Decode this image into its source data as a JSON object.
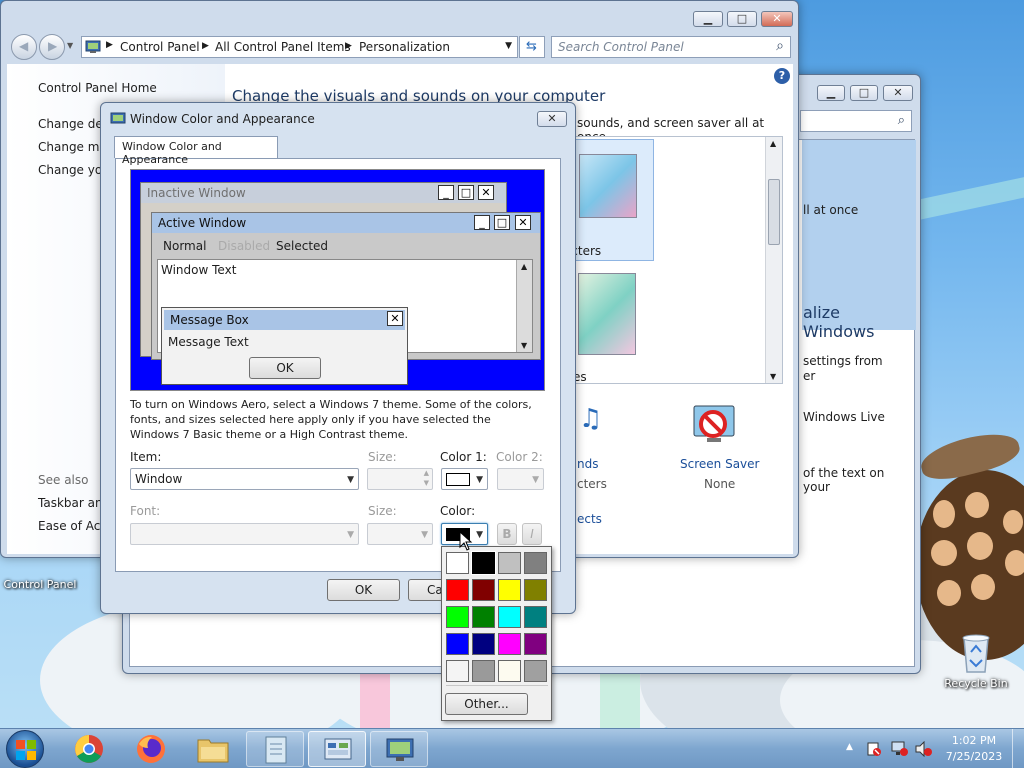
{
  "colors": {
    "selection_blue": "#0000ff",
    "link": "#1a4e99",
    "title_inactive": "#cfdcec"
  },
  "cp": {
    "breadcrumb": [
      "Control Panel",
      "All Control Panel Items",
      "Personalization"
    ],
    "search_placeholder": "Search Control Panel",
    "sidebar": {
      "home": "Control Panel Home",
      "links": [
        "Change des",
        "Change mo",
        "Change you"
      ],
      "see_also": "See also",
      "see_links": [
        "Taskbar and",
        "Ease of Acce"
      ]
    },
    "heading": "Change the visuals and sounds on your computer",
    "subtext": "sounds, and screen saver all at once.",
    "theme_captions": [
      "racters",
      "enes"
    ],
    "screen_saver": "Screen Saver",
    "screen_saver_value": "None",
    "side_items": [
      "nds",
      "cters",
      "ects"
    ]
  },
  "back": {
    "partial_texts": [
      "ll at once",
      "alize Windows",
      "settings from",
      "er",
      "Windows Live",
      "of the text on your"
    ]
  },
  "dialog": {
    "title": "Window Color and Appearance",
    "tab": "Window Color and Appearance",
    "preview": {
      "inactive_title": "Inactive Window",
      "active_title": "Active Window",
      "menu": [
        "Normal",
        "Disabled",
        "Selected"
      ],
      "window_text": "Window Text",
      "msgbox_title": "Message Box",
      "msgbox_text": "Message Text",
      "msgbox_ok": "OK"
    },
    "info": "To turn on Windows Aero, select a Windows 7 theme.  Some of the colors, fonts, and sizes selected here apply only if you have selected the Windows 7 Basic theme or a High Contrast theme.",
    "item_label": "Item:",
    "item_value": "Window",
    "size_label": "Size:",
    "color1_label": "Color 1:",
    "color2_label": "Color 2:",
    "font_label": "Font:",
    "size2_label": "Size:",
    "color_label": "Color:",
    "bold": "B",
    "italic": "I",
    "ok": "OK",
    "cancel": "Ca"
  },
  "palette": {
    "colors": [
      "#ffffff",
      "#000000",
      "#c0c0c0",
      "#808080",
      "#ff0000",
      "#800000",
      "#ffff00",
      "#808000",
      "#00ff00",
      "#008000",
      "#00ffff",
      "#008080",
      "#0000ff",
      "#000080",
      "#ff00ff",
      "#800080",
      "#f4f4f4",
      "#9a9a9a",
      "#fdfbf0",
      "#a0a0a0"
    ],
    "other": "Other..."
  },
  "desktop": {
    "control_panel": "Control Panel",
    "recycle_bin": "Recycle Bin"
  },
  "tray": {
    "time": "1:02 PM",
    "date": "7/25/2023"
  }
}
